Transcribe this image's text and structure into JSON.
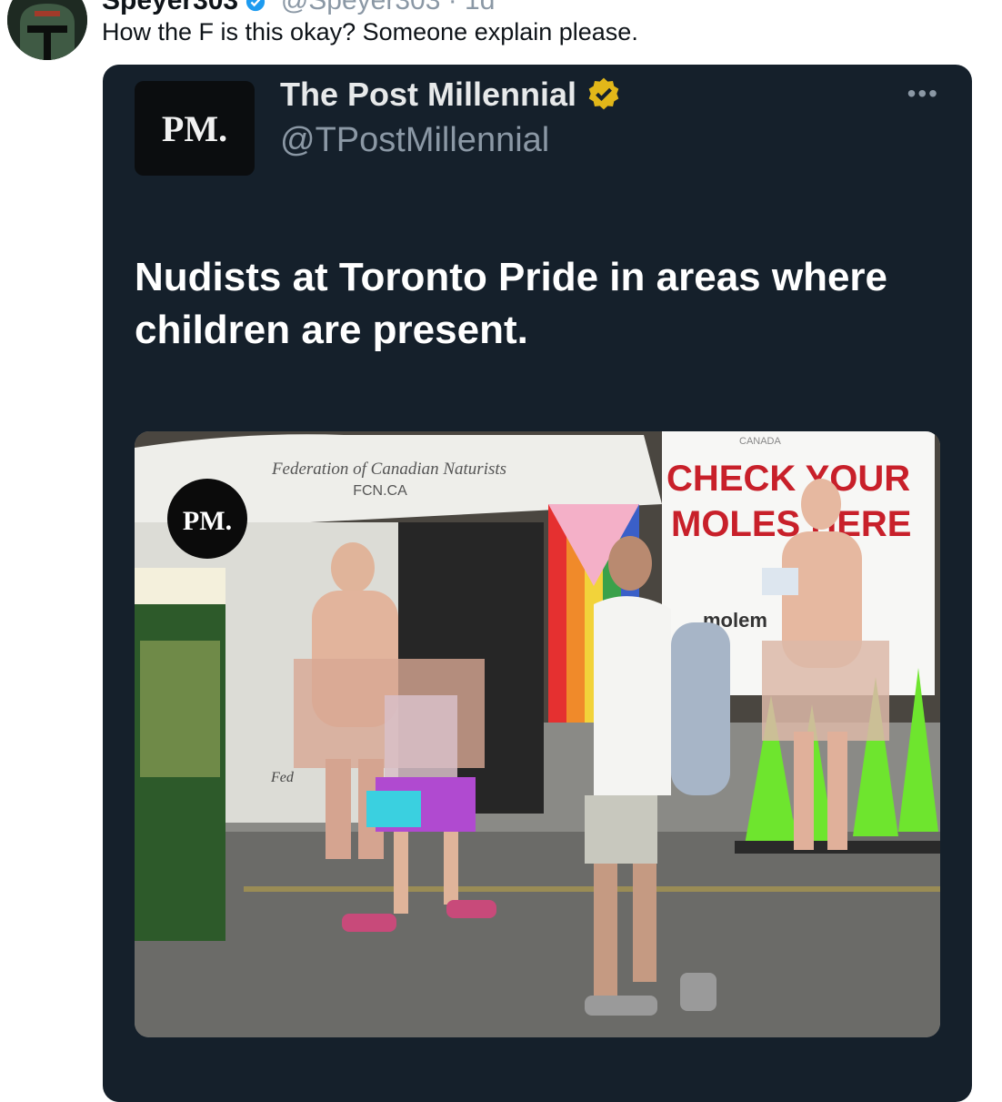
{
  "reply": {
    "author_name": "Speyer303",
    "author_handle": "@Speyer303 · 1d",
    "text": "How the F is this okay? Someone explain please."
  },
  "quoted": {
    "avatar_text": "PM.",
    "name": "The Post Millennial",
    "handle": "@TPostMillennial",
    "more_label": "•••",
    "headline": "Nudists at Toronto Pride in areas where children are present.",
    "photo": {
      "watermark": "PM.",
      "tent_banner_line1": "Federation of Canadian Naturists",
      "tent_banner_line2": "FCN.CA",
      "sign_top": "CANADA",
      "sign_line1": "CHECK YOUR",
      "sign_line2": "MOLES HERE",
      "sign_small": "molem",
      "booth_label": "Fed"
    }
  },
  "colors": {
    "card_bg": "#15202b",
    "verified_gold": "#e2b719",
    "verified_blue": "#1d9bf0",
    "sign_red": "#c8202a",
    "cone_green": "#6ee52e"
  }
}
